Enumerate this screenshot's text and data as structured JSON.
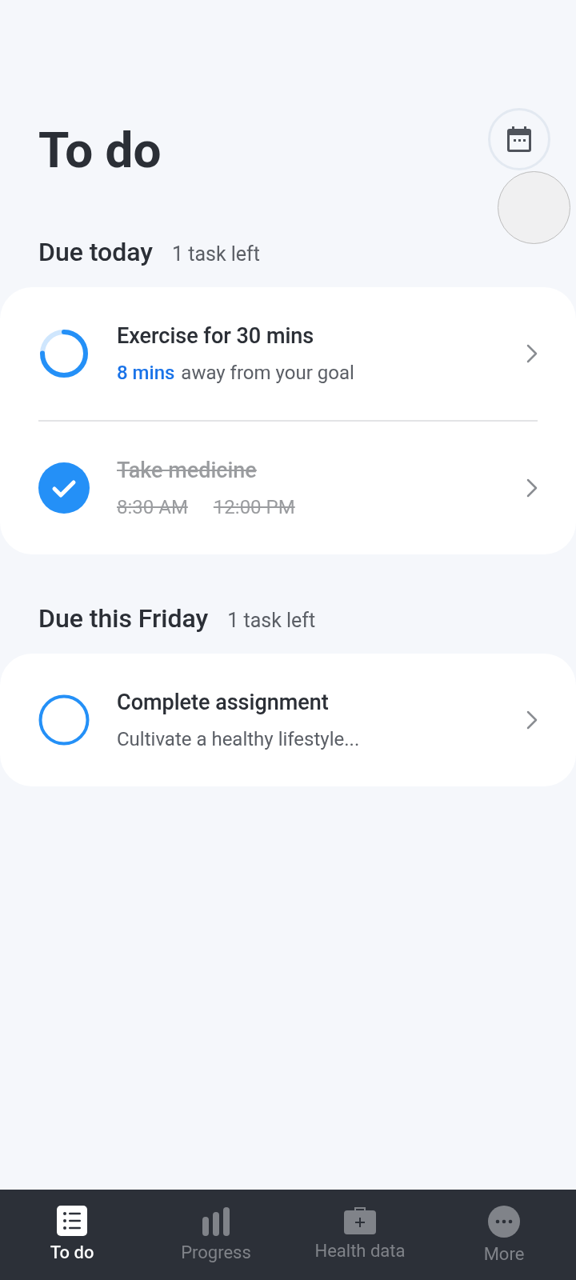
{
  "header": {
    "title": "To do"
  },
  "sections": [
    {
      "title": "Due today",
      "count": "1 task left",
      "tasks": [
        {
          "kind": "progress",
          "title": "Exercise for 30 mins",
          "highlight": "8 mins",
          "subtitle": "away from your goal"
        },
        {
          "kind": "check",
          "checked": true,
          "title": "Take medicine",
          "times": [
            "8:30 AM",
            "12:00 PM"
          ]
        }
      ]
    },
    {
      "title": "Due this Friday",
      "count": "1 task left",
      "tasks": [
        {
          "kind": "check",
          "checked": false,
          "title": "Complete assignment",
          "subtitle": "Cultivate a healthy lifestyle..."
        }
      ]
    }
  ],
  "nav": [
    {
      "kind": "todo",
      "label": "To do",
      "selected": true
    },
    {
      "kind": "progress",
      "label": "Progress",
      "selected": false
    },
    {
      "kind": "health",
      "label": "Health data",
      "selected": false
    },
    {
      "kind": "more",
      "label": "More",
      "selected": false
    }
  ]
}
